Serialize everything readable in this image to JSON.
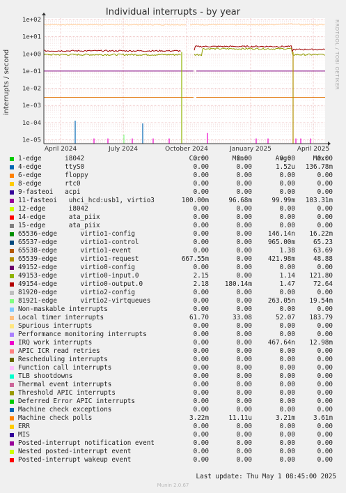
{
  "chart_data": {
    "type": "line",
    "title": "Individual interrupts - by year",
    "ylabel": "interrupts / second",
    "yscale": "log",
    "ylim": [
      6e-06,
      120
    ],
    "y_ticks": [
      "1e-05",
      "1e-04",
      "1e-03",
      "1e-02",
      "1e-01",
      "1e+00",
      "1e+01",
      "1e+02"
    ],
    "x_ticks": [
      "April 2024",
      "July 2024",
      "October 2024",
      "January 2025",
      "April 2025"
    ],
    "watermark": "RRDTOOL / TOBI OETIKER",
    "grid": true,
    "series_approx": [
      {
        "label": "Local timer interrupts",
        "color": "#FFCC99",
        "level": 50
      },
      {
        "label": "virtio1-output.0 / virtio1-request",
        "color": "#A00000",
        "level": 1.5
      },
      {
        "label": "virtio0-input.0",
        "color": "#90A000",
        "level": 0.9
      },
      {
        "label": "11-fasteoi uhci_hcd:usb1, virtio3",
        "color": "#800080",
        "level": 0.1
      },
      {
        "label": "Machine check polls",
        "color": "#E07000",
        "level": 0.003
      }
    ]
  },
  "legend": {
    "headers": {
      "cur": "Cur:",
      "min": "Min:",
      "avg": "Avg:",
      "max": "Max:"
    },
    "rows": [
      {
        "name": "1-edge      i8042",
        "color": "#00CC00",
        "cur": "0.00",
        "min": "0.00",
        "avg": "0.00",
        "max": "0.00"
      },
      {
        "name": "4-edge      ttyS0",
        "color": "#0066B3",
        "cur": "0.00",
        "min": "0.00",
        "avg": "1.52u",
        "max": "136.78m"
      },
      {
        "name": "6-edge      floppy",
        "color": "#FF8000",
        "cur": "0.00",
        "min": "0.00",
        "avg": "0.00",
        "max": "0.00"
      },
      {
        "name": "8-edge      rtc0",
        "color": "#FFCC00",
        "cur": "0.00",
        "min": "0.00",
        "avg": "0.00",
        "max": "0.00"
      },
      {
        "name": "9-fasteoi   acpi",
        "color": "#330099",
        "cur": "0.00",
        "min": "0.00",
        "avg": "0.00",
        "max": "0.00"
      },
      {
        "name": "11-fasteoi   uhci_hcd:usb1, virtio3",
        "color": "#990099",
        "cur": "100.00m",
        "min": "96.68m",
        "avg": "99.99m",
        "max": "103.31m"
      },
      {
        "name": "12-edge      i8042",
        "color": "#CCFF00",
        "cur": "0.00",
        "min": "0.00",
        "avg": "0.00",
        "max": "0.00"
      },
      {
        "name": "14-edge      ata_piix",
        "color": "#FF0000",
        "cur": "0.00",
        "min": "0.00",
        "avg": "0.00",
        "max": "0.00"
      },
      {
        "name": "15-edge      ata_piix",
        "color": "#808080",
        "cur": "0.00",
        "min": "0.00",
        "avg": "0.00",
        "max": "0.00"
      },
      {
        "name": "65536-edge      virtio1-config",
        "color": "#008F00",
        "cur": "0.00",
        "min": "0.00",
        "avg": "146.14n",
        "max": "16.22m"
      },
      {
        "name": "65537-edge      virtio1-control",
        "color": "#00487D",
        "cur": "0.00",
        "min": "0.00",
        "avg": "965.00m",
        "max": "65.23"
      },
      {
        "name": "65538-edge      virtio1-event",
        "color": "#B35A00",
        "cur": "0.00",
        "min": "0.00",
        "avg": "1.38",
        "max": "63.69"
      },
      {
        "name": "65539-edge      virtio1-request",
        "color": "#B38F00",
        "cur": "667.55m",
        "min": "0.00",
        "avg": "421.98m",
        "max": "48.88"
      },
      {
        "name": "49152-edge      virtio0-config",
        "color": "#6B006B",
        "cur": "0.00",
        "min": "0.00",
        "avg": "0.00",
        "max": "0.00"
      },
      {
        "name": "49153-edge      virtio0-input.0",
        "color": "#8FB300",
        "cur": "2.15",
        "min": "0.00",
        "avg": "1.14",
        "max": "121.80"
      },
      {
        "name": "49154-edge      virtio0-output.0",
        "color": "#B30000",
        "cur": "2.18",
        "min": "180.14m",
        "avg": "1.47",
        "max": "72.64"
      },
      {
        "name": "81920-edge      virtio2-config",
        "color": "#BEBEBE",
        "cur": "0.00",
        "min": "0.00",
        "avg": "0.00",
        "max": "0.00"
      },
      {
        "name": "81921-edge      virtio2-virtqueues",
        "color": "#80FF80",
        "cur": "0.00",
        "min": "0.00",
        "avg": "263.05n",
        "max": "19.54m"
      },
      {
        "name": "Non-maskable interrupts",
        "color": "#80C9FF",
        "cur": "0.00",
        "min": "0.00",
        "avg": "0.00",
        "max": "0.00"
      },
      {
        "name": "Local timer interrupts",
        "color": "#FFC080",
        "cur": "61.70",
        "min": "33.08",
        "avg": "52.07",
        "max": "183.79"
      },
      {
        "name": "Spurious interrupts",
        "color": "#FFE680",
        "cur": "0.00",
        "min": "0.00",
        "avg": "0.00",
        "max": "0.00"
      },
      {
        "name": "Performance monitoring interrupts",
        "color": "#AA80FF",
        "cur": "0.00",
        "min": "0.00",
        "avg": "0.00",
        "max": "0.00"
      },
      {
        "name": "IRQ work interrupts",
        "color": "#EE00CC",
        "cur": "0.00",
        "min": "0.00",
        "avg": "467.64n",
        "max": "12.98m"
      },
      {
        "name": "APIC ICR read retries",
        "color": "#FF8080",
        "cur": "0.00",
        "min": "0.00",
        "avg": "0.00",
        "max": "0.00"
      },
      {
        "name": "Rescheduling interrupts",
        "color": "#666600",
        "cur": "0.00",
        "min": "0.00",
        "avg": "0.00",
        "max": "0.00"
      },
      {
        "name": "Function call interrupts",
        "color": "#FFBFFF",
        "cur": "0.00",
        "min": "0.00",
        "avg": "0.00",
        "max": "0.00"
      },
      {
        "name": "TLB shootdowns",
        "color": "#00FFCC",
        "cur": "0.00",
        "min": "0.00",
        "avg": "0.00",
        "max": "0.00"
      },
      {
        "name": "Thermal event interrupts",
        "color": "#CC6699",
        "cur": "0.00",
        "min": "0.00",
        "avg": "0.00",
        "max": "0.00"
      },
      {
        "name": "Threshold APIC interrupts",
        "color": "#999900",
        "cur": "0.00",
        "min": "0.00",
        "avg": "0.00",
        "max": "0.00"
      },
      {
        "name": "Deferred Error APIC interrupts",
        "color": "#00CC00",
        "cur": "0.00",
        "min": "0.00",
        "avg": "0.00",
        "max": "0.00"
      },
      {
        "name": "Machine check exceptions",
        "color": "#0066B3",
        "cur": "0.00",
        "min": "0.00",
        "avg": "0.00",
        "max": "0.00"
      },
      {
        "name": "Machine check polls",
        "color": "#FF8000",
        "cur": "3.22m",
        "min": "11.11u",
        "avg": "3.21m",
        "max": "3.61m"
      },
      {
        "name": "ERR",
        "color": "#FFCC00",
        "cur": "0.00",
        "min": "0.00",
        "avg": "0.00",
        "max": "0.00"
      },
      {
        "name": "MIS",
        "color": "#330099",
        "cur": "0.00",
        "min": "0.00",
        "avg": "0.00",
        "max": "0.00"
      },
      {
        "name": "Posted-interrupt notification event",
        "color": "#990099",
        "cur": "0.00",
        "min": "0.00",
        "avg": "0.00",
        "max": "0.00"
      },
      {
        "name": "Nested posted-interrupt event",
        "color": "#CCFF00",
        "cur": "0.00",
        "min": "0.00",
        "avg": "0.00",
        "max": "0.00"
      },
      {
        "name": "Posted-interrupt wakeup event",
        "color": "#FF0000",
        "cur": "0.00",
        "min": "0.00",
        "avg": "0.00",
        "max": "0.00"
      }
    ]
  },
  "footer": {
    "last_update": "Last update: Thu May  1 08:45:00 2025",
    "munin": "Munin 2.0.67"
  }
}
